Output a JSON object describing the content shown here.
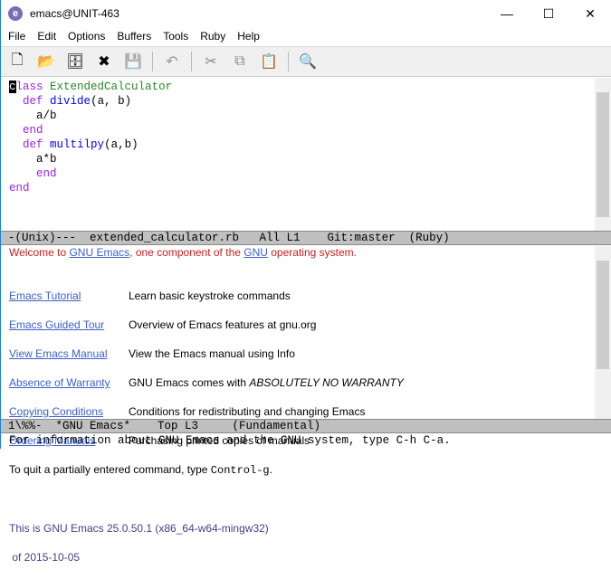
{
  "window": {
    "title": "emacs@UNIT-463",
    "minimize": "—",
    "maximize": "☐",
    "close": "✕"
  },
  "menu": [
    "File",
    "Edit",
    "Options",
    "Buffers",
    "Tools",
    "Ruby",
    "Help"
  ],
  "toolbar": [
    {
      "name": "new-file",
      "glyph": "🗋"
    },
    {
      "name": "open-folder",
      "glyph": "📂"
    },
    {
      "name": "file-cabinet",
      "glyph": "🗄"
    },
    {
      "name": "close-buffer",
      "glyph": "✖"
    },
    {
      "name": "save",
      "glyph": "💾"
    },
    {
      "name": "undo",
      "glyph": "↶"
    },
    {
      "name": "cut",
      "glyph": "✂"
    },
    {
      "name": "copy",
      "glyph": "⧉"
    },
    {
      "name": "paste",
      "glyph": "📋"
    },
    {
      "name": "search",
      "glyph": "🔍"
    }
  ],
  "code": {
    "l1_c": "c",
    "l1_kw": "lass",
    "l1_cls": "ExtendedCalculator",
    "l2_kw": "def",
    "l2_fn": "divide",
    "l2_rest": "(a, b)",
    "l3": "a/b",
    "l4": "end",
    "l5_kw": "def",
    "l5_fn": "multilpy",
    "l5_rest": "(a,b)",
    "l6": "a*b",
    "l7": "end",
    "l8": "end"
  },
  "modeline1": "-(Unix)---  extended_calculator.rb   All L1    Git:master  (Ruby)",
  "help": {
    "welcome_1": "Welcome to ",
    "welcome_link1": "GNU Emacs",
    "welcome_2": ", one component of the ",
    "welcome_link2": "GNU",
    "welcome_3": " operating system.",
    "items": [
      {
        "link": "Emacs Tutorial",
        "desc": "Learn basic keystroke commands"
      },
      {
        "link": "Emacs Guided Tour",
        "desc": "Overview of Emacs features at gnu.org"
      },
      {
        "link": "View Emacs Manual",
        "desc": "View the Emacs manual using Info"
      },
      {
        "link": "Absence of Warranty",
        "desc": "GNU Emacs comes with ",
        "desc_em": "ABSOLUTELY NO WARRANTY"
      },
      {
        "link": "Copying Conditions",
        "desc": "Conditions for redistributing and changing Emacs"
      },
      {
        "link": "Ordering Manuals",
        "desc": "Purchasing printed copies of manuals"
      }
    ],
    "quit_text": "To quit a partially entered command, type ",
    "quit_key": "Control-g",
    "quit_end": ".",
    "version": "This is GNU Emacs 25.0.50.1 (x86_64-w64-mingw32)",
    "date": " of 2015-10-05"
  },
  "modeline2": "1\\%%-  *GNU Emacs*    Top L3     (Fundamental)",
  "echo": "For information about GNU Emacs and the GNU system, type C-h C-a."
}
